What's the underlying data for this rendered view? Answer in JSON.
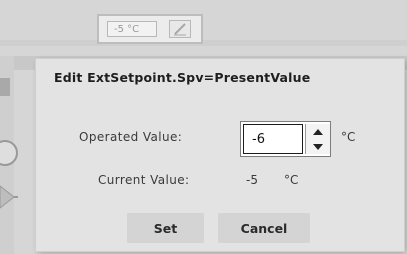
{
  "background_widget": {
    "value": "-5 °C"
  },
  "dialog": {
    "title": "Edit ExtSetpoint.Spv=PresentValue",
    "operated_label": "Operated Value:",
    "operated_value": "-6",
    "operated_unit": "°C",
    "current_label": "Current Value:",
    "current_value": "-5",
    "current_unit": "°C",
    "set_label": "Set",
    "cancel_label": "Cancel"
  },
  "icons": {
    "spin_up": "triangle-up-icon",
    "spin_down": "triangle-down-icon",
    "edit": "edit-pencil-icon"
  }
}
